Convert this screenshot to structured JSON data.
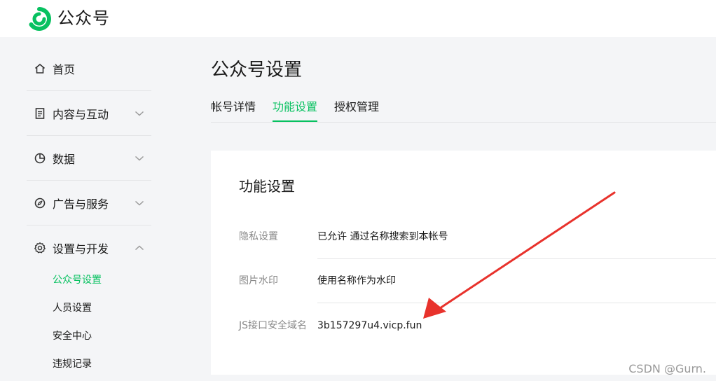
{
  "header": {
    "brand": "公众号",
    "logo_icon": "wechat-official-account-logo",
    "accent": "#07c160"
  },
  "sidebar": {
    "items": [
      {
        "label": "首页",
        "icon": "home-icon"
      },
      {
        "label": "内容与互动",
        "icon": "document-icon",
        "expanded": false
      },
      {
        "label": "数据",
        "icon": "pie-chart-icon",
        "expanded": false
      },
      {
        "label": "广告与服务",
        "icon": "compass-icon",
        "expanded": false
      },
      {
        "label": "设置与开发",
        "icon": "gear-icon",
        "expanded": true
      }
    ],
    "sub_items": [
      {
        "label": "公众号设置",
        "active": true
      },
      {
        "label": "人员设置",
        "active": false
      },
      {
        "label": "安全中心",
        "active": false
      },
      {
        "label": "违规记录",
        "active": false
      }
    ]
  },
  "main": {
    "title": "公众号设置",
    "tabs": [
      {
        "label": "帐号详情",
        "active": false
      },
      {
        "label": "功能设置",
        "active": true
      },
      {
        "label": "授权管理",
        "active": false
      }
    ],
    "card": {
      "title": "功能设置",
      "rows": [
        {
          "label": "隐私设置",
          "value": "已允许 通过名称搜索到本帐号"
        },
        {
          "label": "图片水印",
          "value": "使用名称作为水印"
        },
        {
          "label": "JS接口安全域名",
          "value": "3b157297u4.vicp.fun"
        }
      ]
    }
  },
  "annotation": {
    "arrow_color": "#e8322c"
  },
  "watermark": "CSDN @Gurn."
}
